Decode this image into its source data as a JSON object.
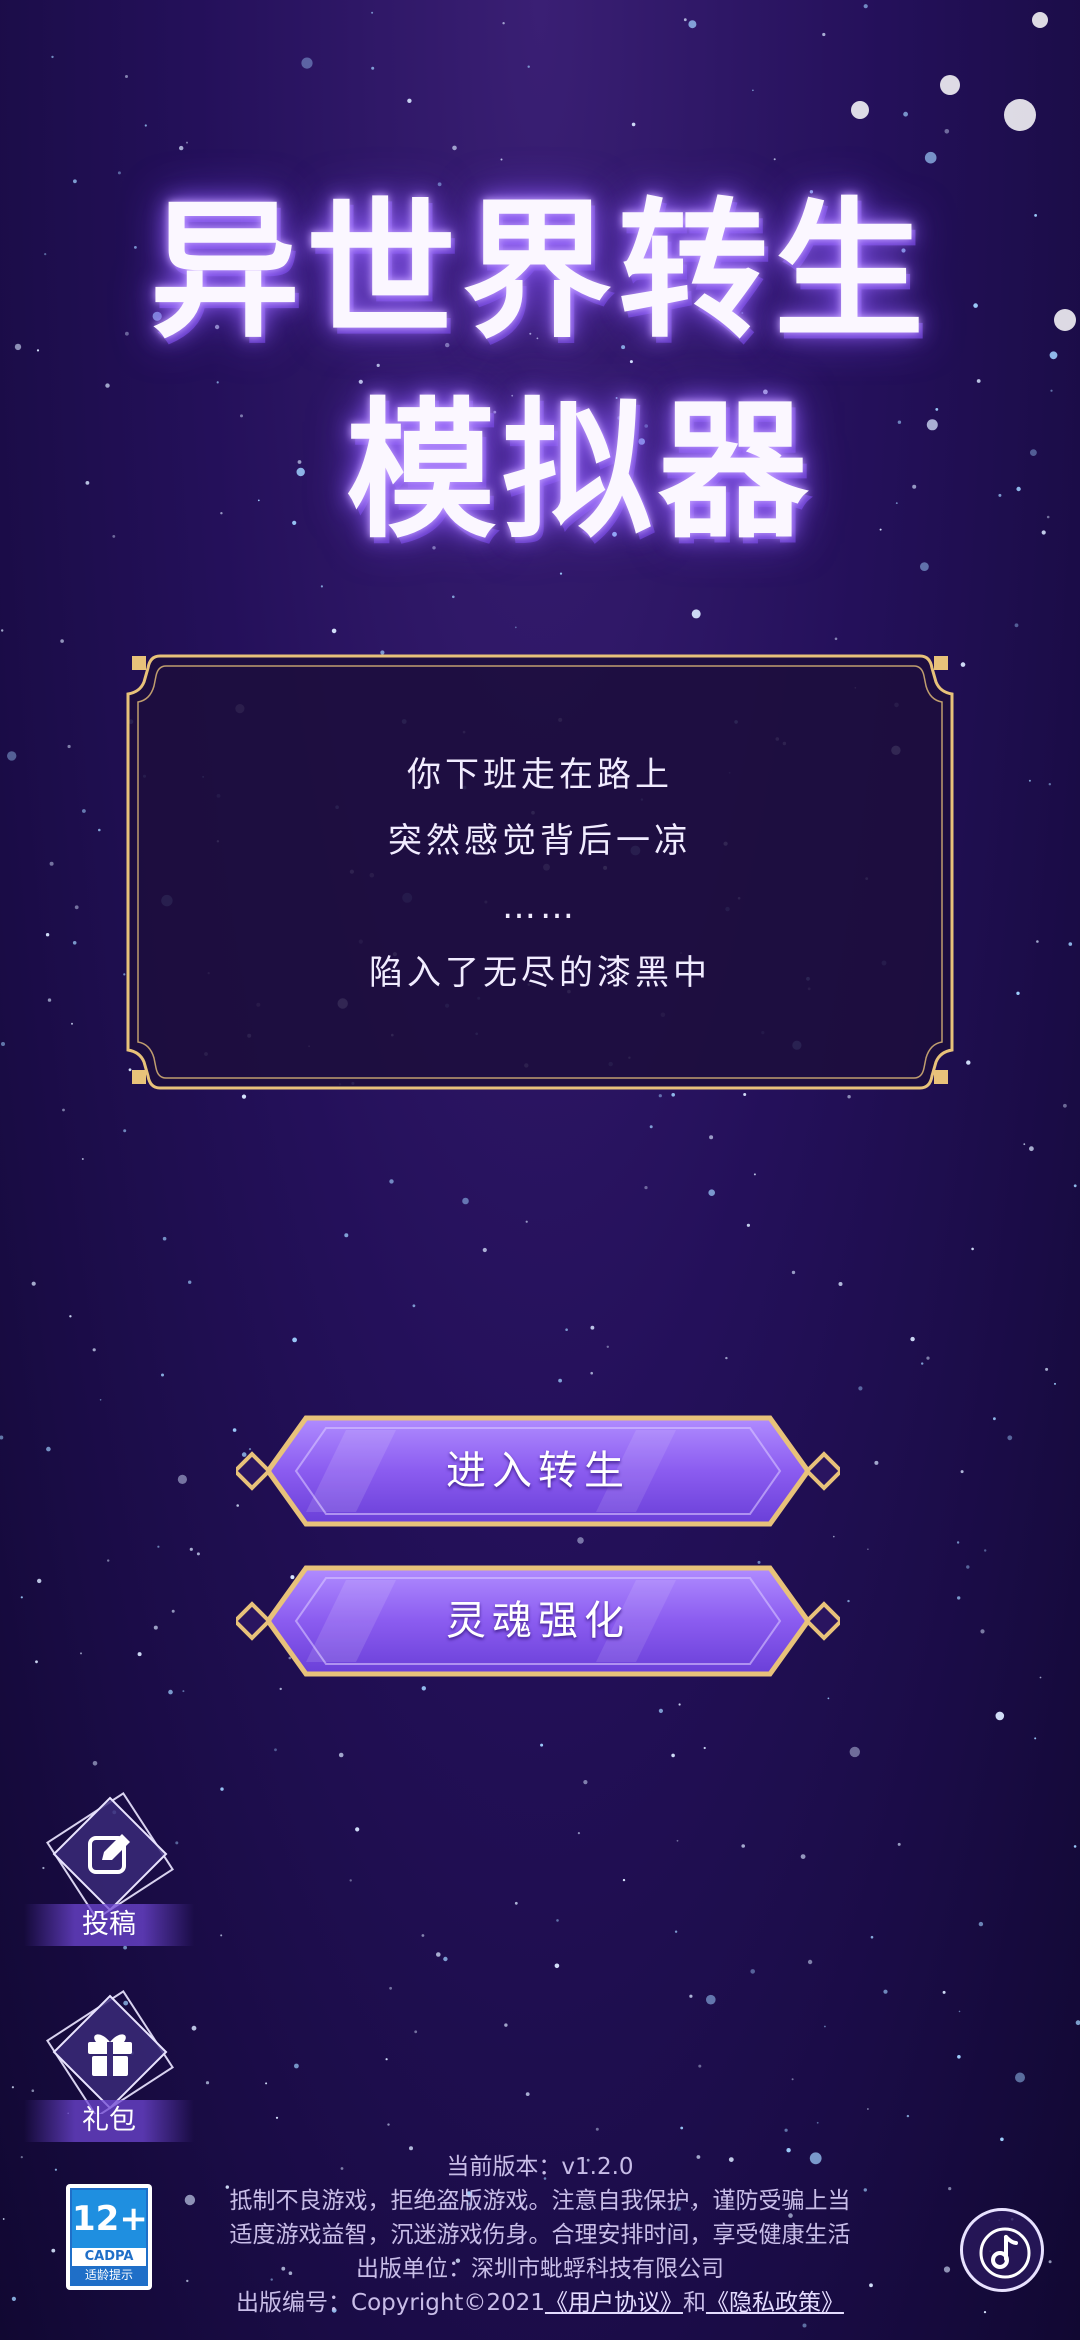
{
  "game": {
    "title_line1": "异世界转生",
    "title_line2": "模拟器"
  },
  "story": {
    "lines": [
      "你下班走在路上",
      "突然感觉背后一凉",
      "……",
      "陷入了无尽的漆黑中"
    ]
  },
  "buttons": {
    "enter_reincarnation": "进入转生",
    "soul_enhance": "灵魂强化"
  },
  "side": {
    "submit_label": "投稿",
    "gift_label": "礼包"
  },
  "footer": {
    "version": "当前版本：v1.2.0",
    "health_notice_1": "抵制不良游戏，拒绝盗版游戏。注意自我保护，谨防受骗上当",
    "health_notice_2": "适度游戏益智，沉迷游戏伤身。合理安排时间，享受健康生活",
    "publisher": "出版单位：深圳市蚍蜉科技有限公司",
    "publish_no_prefix": "出版编号：Copyright©2021",
    "user_agreement": "《用户协议》",
    "and": "和",
    "privacy_policy": "《隐私政策》"
  },
  "age_rating": {
    "age": "12+",
    "org": "CADPA",
    "tip": "适龄提示"
  },
  "icons": {
    "submit": "edit-icon",
    "gift": "gift-icon",
    "music": "music-note-icon"
  },
  "colors": {
    "background": "#24105a",
    "button_purple": "#8b5cf0",
    "gold_border": "#e8c27a",
    "panel_fill": "#1c0e3c"
  }
}
